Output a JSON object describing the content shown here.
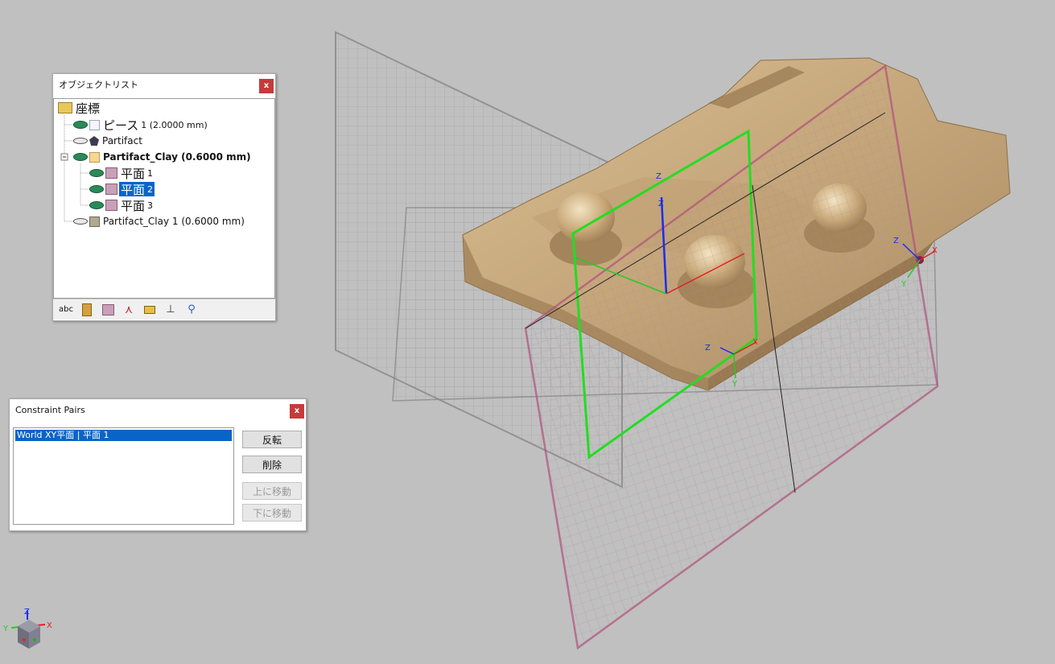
{
  "object_list": {
    "title": "オブジェクトリスト",
    "close": "x",
    "items": [
      {
        "label": "座標",
        "sub": ""
      },
      {
        "label": "ピース",
        "sub": "1 (2.0000 mm)"
      },
      {
        "label": "Partifact",
        "sub": ""
      },
      {
        "label": "Partifact_Clay (0.6000 mm)",
        "sub": ""
      },
      {
        "label": "平面",
        "sub": "1"
      },
      {
        "label": "平面",
        "sub": "2"
      },
      {
        "label": "平面",
        "sub": "3"
      },
      {
        "label": "Partifact_Clay 1 (0.6000 mm)",
        "sub": ""
      }
    ],
    "toolbar_text": "abc"
  },
  "constraint_pairs": {
    "title": "Constraint Pairs",
    "close": "x",
    "list_item": "World XY平面 | 平面 1",
    "buttons": {
      "flip": "反転",
      "delete": "削除",
      "move_up": "上に移動",
      "move_down": "下に移動"
    }
  },
  "axes": {
    "x": "X",
    "y": "Y",
    "z": "Z"
  },
  "colors": {
    "background": "#c0c0c0",
    "model": "#c9ad80",
    "plane_selected": "#22dd22",
    "plane_magenta": "#b0507a",
    "plane_gray": "#8a8a8a",
    "selection": "#0a64c8"
  },
  "icons": [
    "folder-icon",
    "eye-icon",
    "cube-icon",
    "pentagon-icon",
    "plane-icon",
    "measure-icon",
    "axis-icon",
    "search-icon"
  ]
}
